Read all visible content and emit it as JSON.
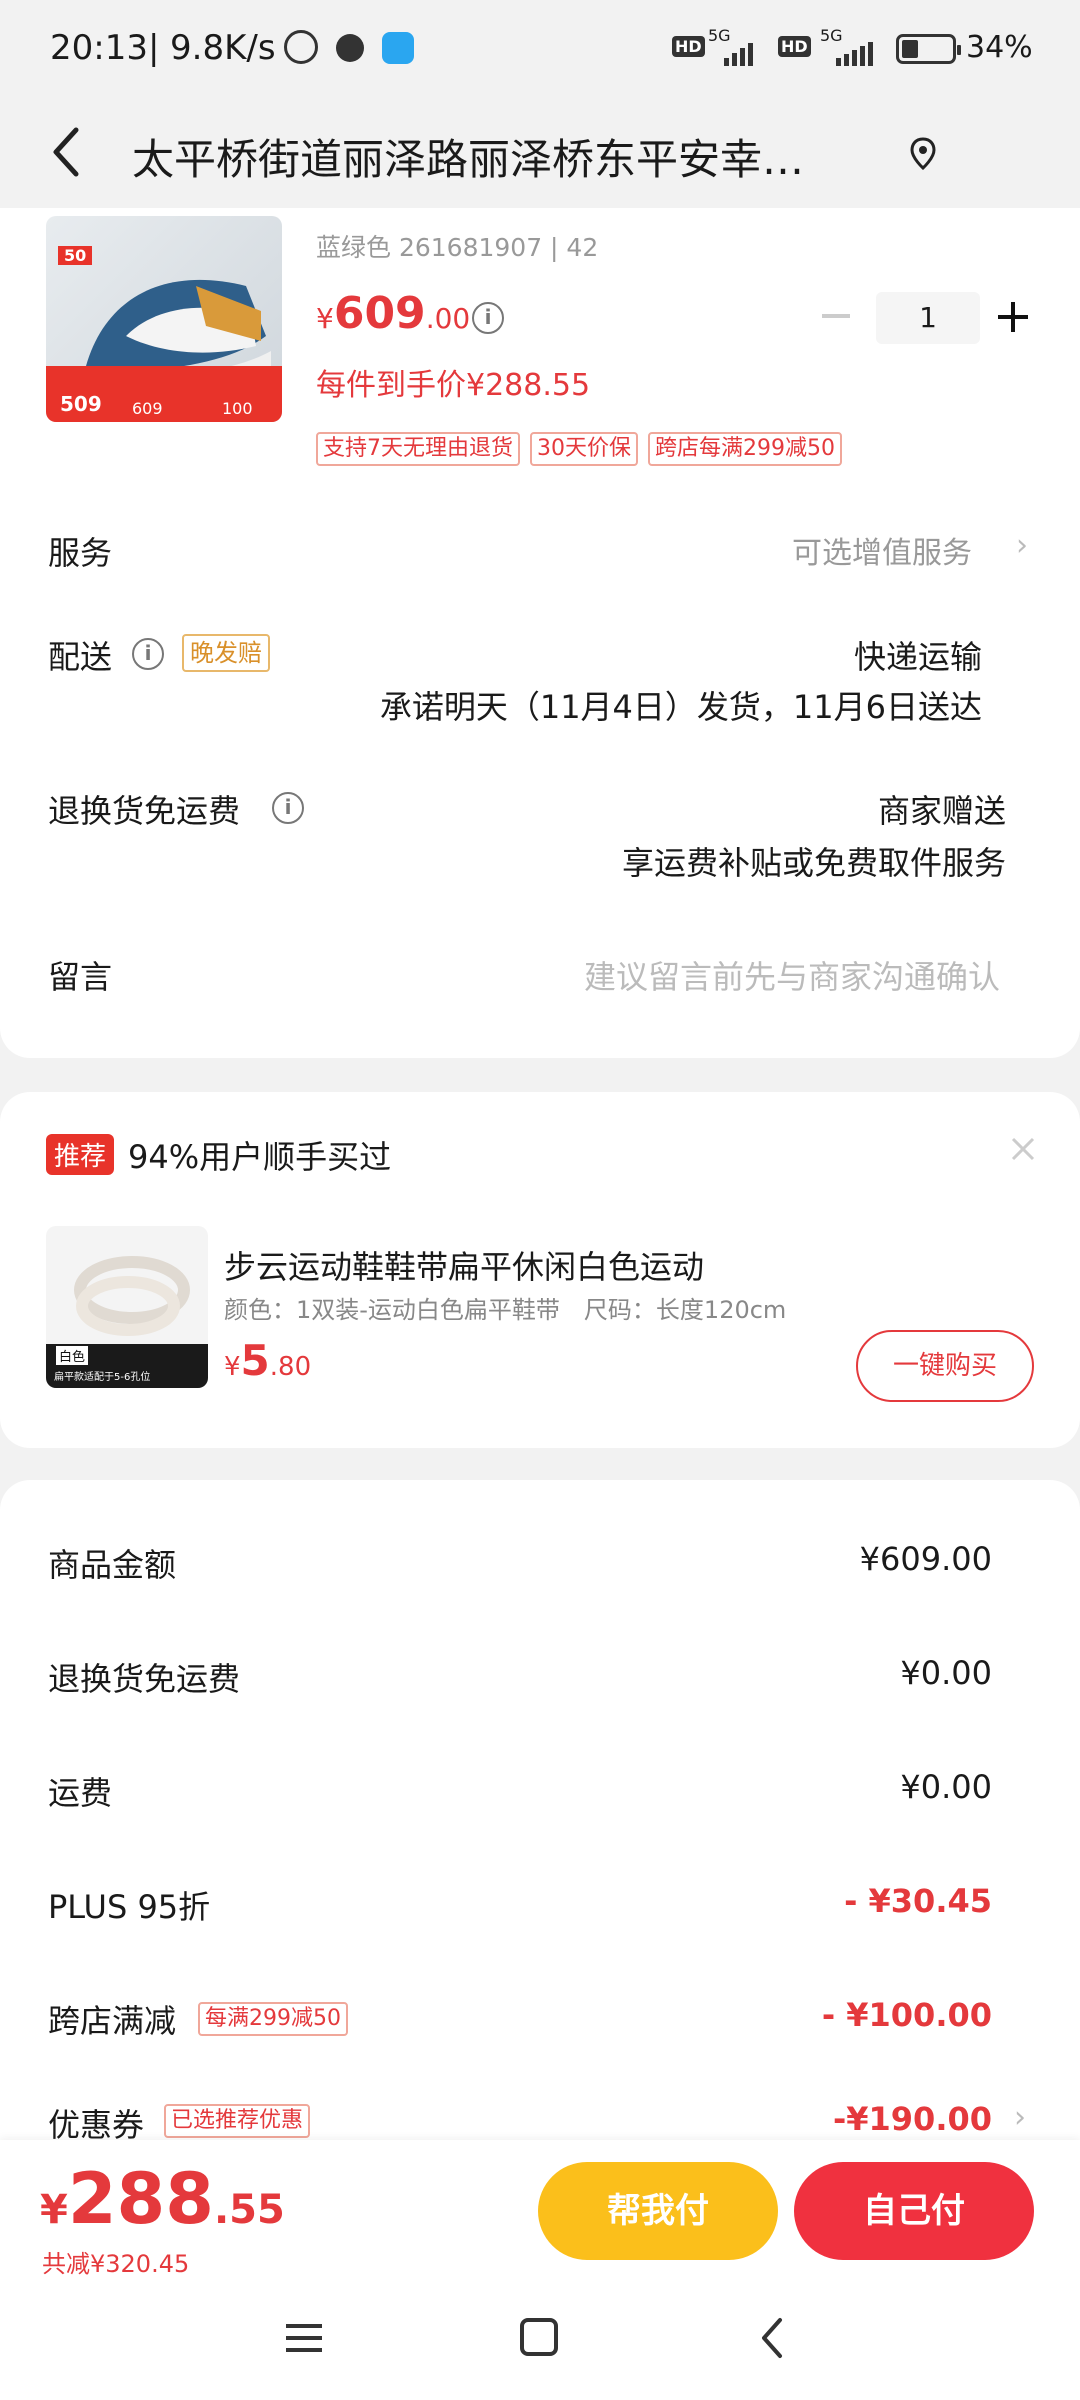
{
  "status_bar": {
    "time": "20:13",
    "speed": "9.8K/s",
    "hd1": "HD",
    "net1": "5G",
    "hd2": "HD",
    "net2": "5G",
    "battery": "34%"
  },
  "header": {
    "address": "太平桥街道丽泽路丽泽桥东平安幸…"
  },
  "product": {
    "spec": "蓝绿色 261681907 | 42",
    "price_symbol": "¥",
    "price_int": "609",
    "price_dec": ".00",
    "net_price_label": "每件到手价¥288.55",
    "quantity": "1",
    "tags": [
      "支持7天无理由退货",
      "30天价保",
      "跨店每满299减50"
    ],
    "thumb_badge": "50",
    "thumb_prices": [
      "509",
      "609",
      "100"
    ]
  },
  "service": {
    "label": "服务",
    "value": "可选增值服务"
  },
  "delivery": {
    "label": "配送",
    "badge": "晚发赔",
    "method": "快递运输",
    "promise": "承诺明天（11月4日）发货，11月6日送达"
  },
  "return_ship": {
    "label": "退换货免运费",
    "value1": "商家赠送",
    "value2": "享运费补贴或免费取件服务"
  },
  "message": {
    "label": "留言",
    "placeholder": "建议留言前先与商家沟通确认"
  },
  "recommend": {
    "badge": "推荐",
    "title": "94%用户顺手买过",
    "item_name": "步云运动鞋鞋带扁平休闲白色运动",
    "item_spec": "颜色：1双装-运动白色扁平鞋带　尺码：长度120cm",
    "item_price_symbol": "¥",
    "item_price_int": "5",
    "item_price_dec": ".80",
    "buy_button": "一键购买",
    "thumb_label": "白色",
    "thumb_caption": "扁平款适配于5-6孔位"
  },
  "summary": {
    "rows": [
      {
        "label": "商品金额",
        "value": "¥609.00",
        "tag": ""
      },
      {
        "label": "退换货免运费",
        "value": "¥0.00",
        "tag": ""
      },
      {
        "label": "运费",
        "value": "¥0.00",
        "tag": ""
      },
      {
        "label": "PLUS 95折",
        "value": "- ¥30.45",
        "tag": ""
      },
      {
        "label": "跨店满减",
        "value": "- ¥100.00",
        "tag": "每满299减50"
      },
      {
        "label": "优惠券",
        "value": "-¥190.00",
        "tag": "已选推荐优惠"
      }
    ]
  },
  "bottom_bar": {
    "total_symbol": "¥",
    "total_int": "288",
    "total_dec": ".55",
    "saved": "共减¥320.45",
    "help_pay": "帮我付",
    "self_pay": "自己付"
  },
  "colors": {
    "accent_red": "#e4393c",
    "help_yellow": "#fbbf1b",
    "pay_red": "#f0313f"
  }
}
